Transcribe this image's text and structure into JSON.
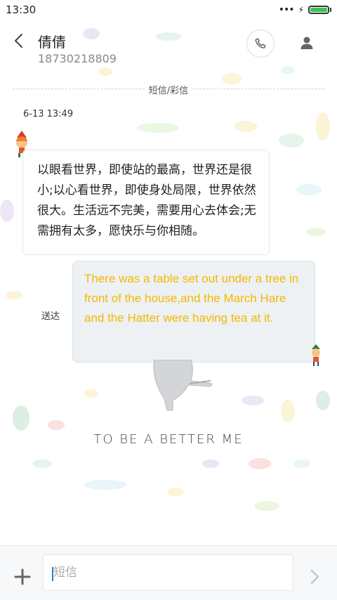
{
  "status_bar": {
    "time": "13:30",
    "battery_level": 1.0
  },
  "header": {
    "contact_name": "倩倩",
    "contact_number": "18730218809"
  },
  "thread": {
    "channel_label": "短信/彩信",
    "timestamp": "6-13 13:49",
    "incoming_message": "以眼看世界，即使站的最高，世界还是很小;以心看世界，即使身处局限，世界依然很大。生活远不完美，需要用心去体会;无需拥有太多，愿快乐与你相随。",
    "outgoing_message": "There was a table set out under a tree in front of the house,and the March Hare and the Hatter were having tea at it.",
    "delivery_status": "送达"
  },
  "background": {
    "tagline": "TO BE A BETTER ME"
  },
  "composer": {
    "placeholder": "短信"
  },
  "colors": {
    "outgoing_text": "#f5b800",
    "battery": "#34c759",
    "cursor": "#2a7bd5"
  }
}
